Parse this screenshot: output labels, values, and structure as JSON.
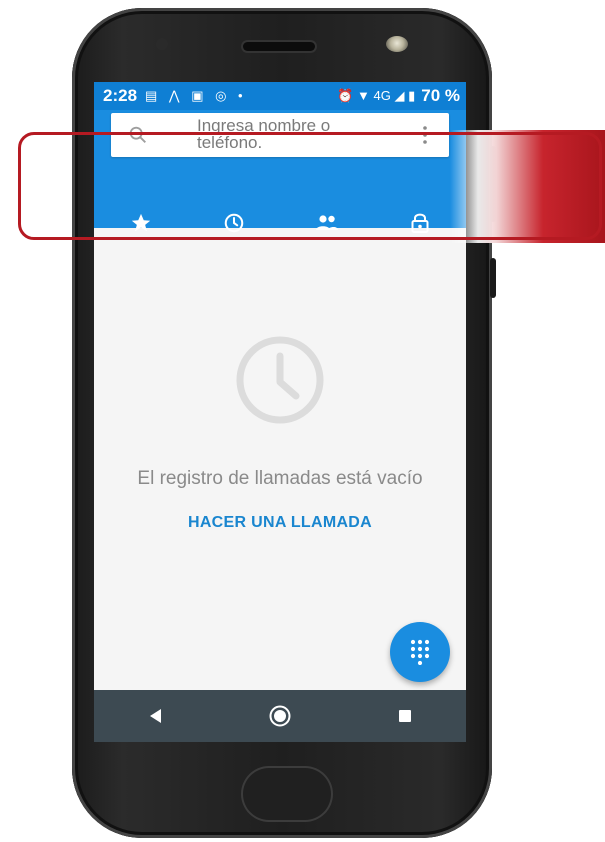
{
  "status_bar": {
    "time": "2:28",
    "left_icons": "▤ ⋀ ▣ ◎ •",
    "right_icons": "⏰ ▼ 4G ◢ ▮",
    "battery": "70 %"
  },
  "search": {
    "placeholder": "Ingresa nombre o teléfono."
  },
  "tabs": [
    {
      "icon": "star-icon",
      "active": false
    },
    {
      "icon": "clock-icon",
      "active": true
    },
    {
      "icon": "contacts-icon",
      "active": false
    },
    {
      "icon": "lock-icon",
      "active": false
    }
  ],
  "empty_state": {
    "message": "El registro de llamadas está vacío",
    "action": "HACER UNA LLAMADA"
  },
  "colors": {
    "accent": "#1a8de0",
    "status_bar": "#0f7fd4",
    "link": "#1a86cf",
    "highlight": "#b51a22",
    "navbar": "#3d4a52"
  }
}
